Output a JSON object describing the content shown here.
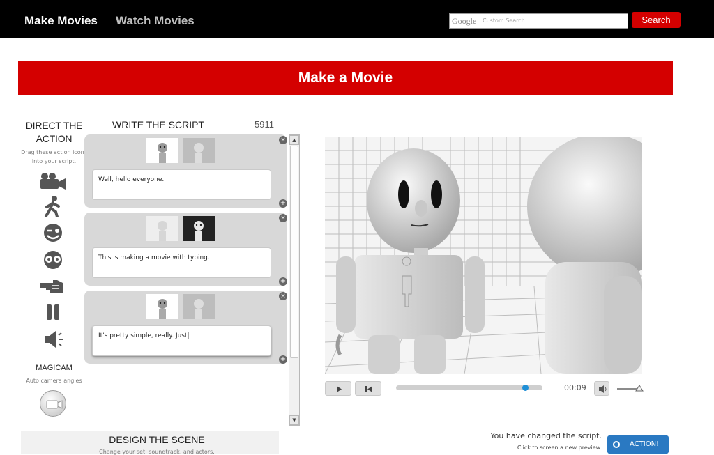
{
  "nav": {
    "make_movies": "Make Movies",
    "watch_movies": "Watch Movies"
  },
  "search": {
    "google_label": "Google",
    "placeholder": "Custom Search",
    "button_label": "Search"
  },
  "banner": {
    "title": "Make a Movie"
  },
  "direct": {
    "title": "DIRECT THE ACTION",
    "subtitle": "Drag these action icons into your script.",
    "tools": [
      "camera-icon",
      "walk-icon",
      "wink-face-icon",
      "eyes-face-icon",
      "point-hand-icon",
      "pause-icon",
      "speaker-icon"
    ]
  },
  "magicam": {
    "title": "MAGICAM",
    "subtitle": "Auto camera angles"
  },
  "script": {
    "title": "WRITE THE SCRIPT",
    "count": "5911",
    "lines": [
      {
        "text": "Well, hello everyone.",
        "speaker": "left"
      },
      {
        "text": "This is making a movie with typing.",
        "speaker": "right"
      },
      {
        "text": "It's pretty simple, really. Just|",
        "speaker": "left"
      }
    ]
  },
  "design": {
    "title": "DESIGN THE SCENE",
    "subtitle": "Change your set, soundtrack, and actors."
  },
  "player": {
    "time": "00:09",
    "progress_fraction": 0.88
  },
  "status": {
    "message": "You have changed the script.",
    "hint": "Click to screen a new preview.",
    "action_label": "ACTION!"
  },
  "colors": {
    "brand_red": "#d40000",
    "action_blue": "#2a79c2",
    "progress_knob": "#1e8fd6"
  }
}
